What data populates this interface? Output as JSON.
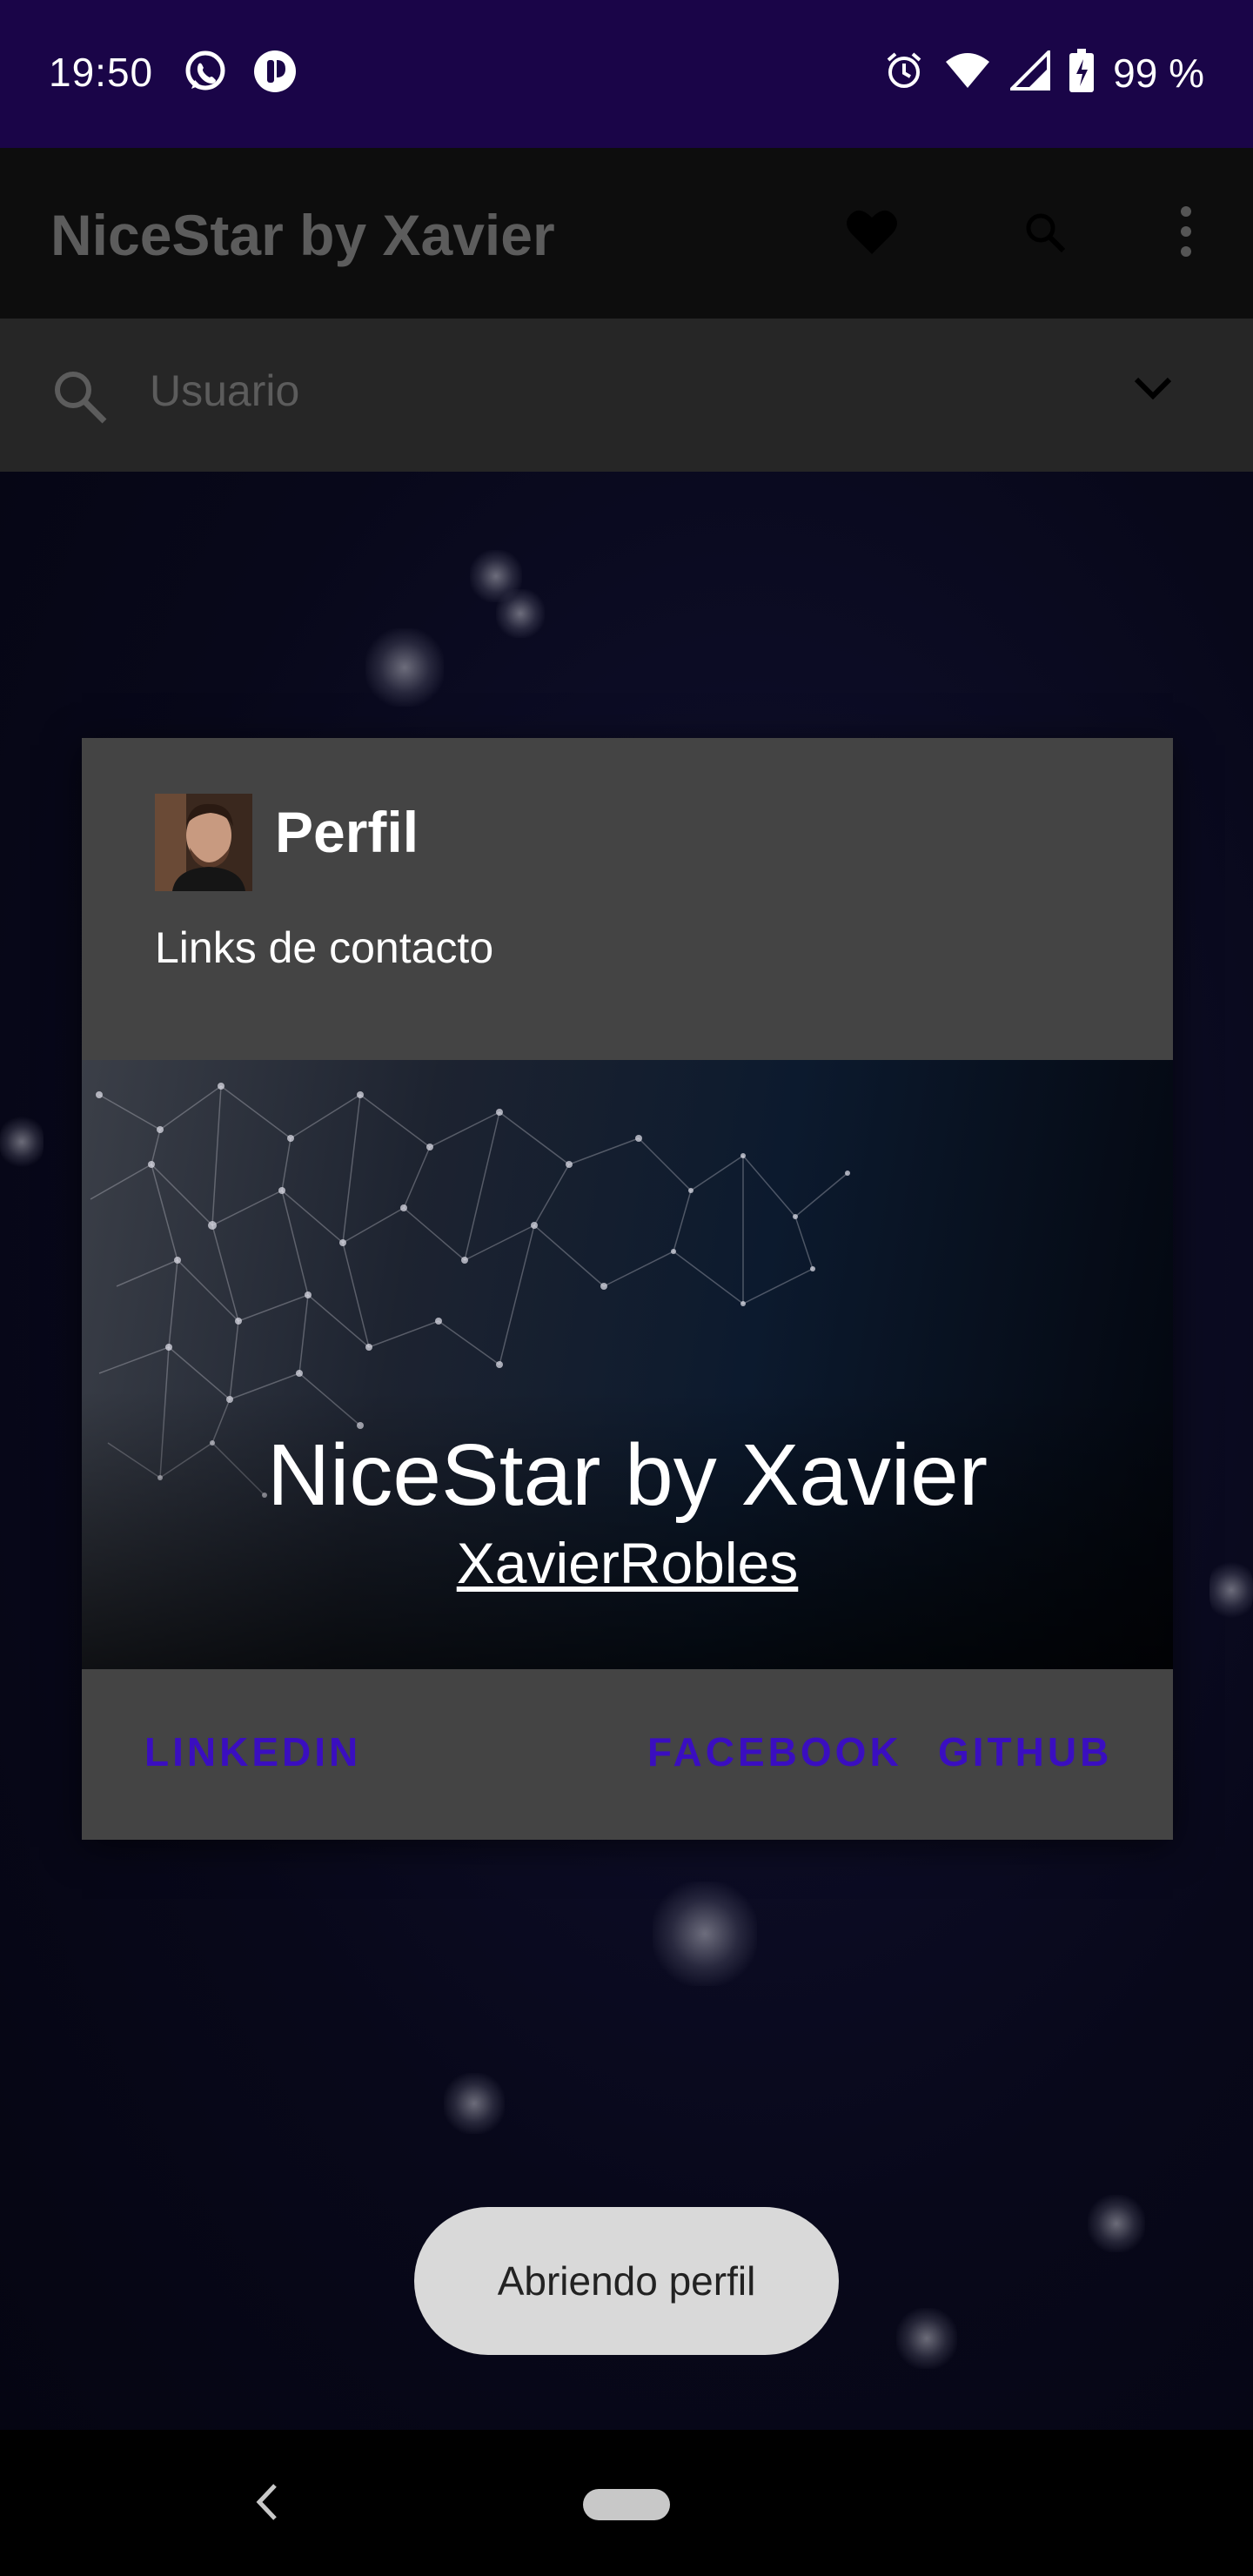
{
  "status_bar": {
    "time": "19:50",
    "battery_text": "99 %",
    "left_icons": [
      "whatsapp-icon",
      "notification-icon"
    ],
    "right_icons": [
      "alarm-icon",
      "wifi-icon",
      "cell-signal-icon",
      "battery-charging-icon"
    ]
  },
  "toolbar": {
    "title": "NiceStar by Xavier",
    "icons": [
      "heart-icon",
      "search-icon",
      "more-vert-icon"
    ]
  },
  "search": {
    "placeholder": "Usuario"
  },
  "dialog": {
    "title": "Perfil",
    "subtitle": "Links de contacto",
    "banner_app_name": "NiceStar by Xavier",
    "banner_username": "XavierRobles",
    "actions": {
      "linkedin": "LINKEDIN",
      "facebook": "FACEBOOK",
      "github": "GITHUB"
    },
    "action_color": "#3a0ec0"
  },
  "toast": {
    "message": "Abriendo perfil"
  },
  "colors": {
    "status_bar": "#1a0548",
    "dialog_bg": "#444444",
    "toast_bg": "#d9d9d9"
  }
}
